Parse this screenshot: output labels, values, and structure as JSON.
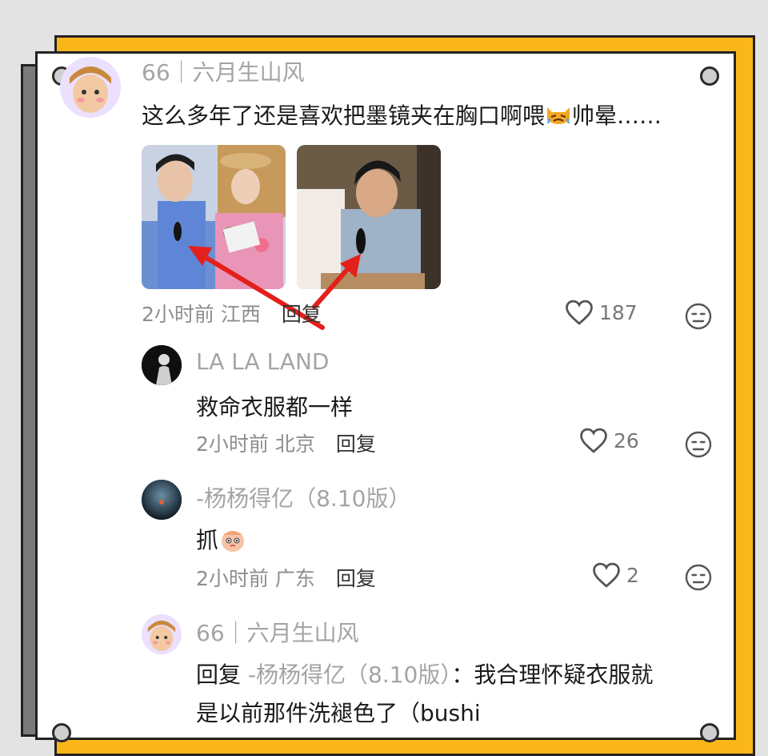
{
  "comments": [
    {
      "author": "66｜六月生山风",
      "text": "这么多年了还是喜欢把墨镜夹在胸口啊喂",
      "text_suffix": "帅晕……",
      "time": "2小时前",
      "location": "江西",
      "reply_label": "回复",
      "likes": "187"
    },
    {
      "author": "LA LA LAND",
      "text": "救命衣服都一样",
      "time": "2小时前",
      "location": "北京",
      "reply_label": "回复",
      "likes": "26"
    },
    {
      "author": "-杨杨得亿（8.10版）",
      "text": "抓",
      "time": "2小时前",
      "location": "广东",
      "reply_label": "回复",
      "likes": "2"
    },
    {
      "author": "66｜六月生山风",
      "reply_prefix": "回复",
      "reply_to": "-杨杨得亿（8.10版）",
      "text_line1": "：我合理怀疑衣服就",
      "text_line2": "是以前那件洗褪色了（bushi"
    }
  ],
  "icons": {
    "like": "heart-outline-icon",
    "dislike": "meh-face-icon",
    "emoji_1": "crying-cat-emoji",
    "emoji_2": "peach-face-emoji"
  },
  "colors": {
    "frame_accent": "#fbb61a",
    "frame_side": "#7b7b7b",
    "annotation_arrow": "#e3201b"
  }
}
